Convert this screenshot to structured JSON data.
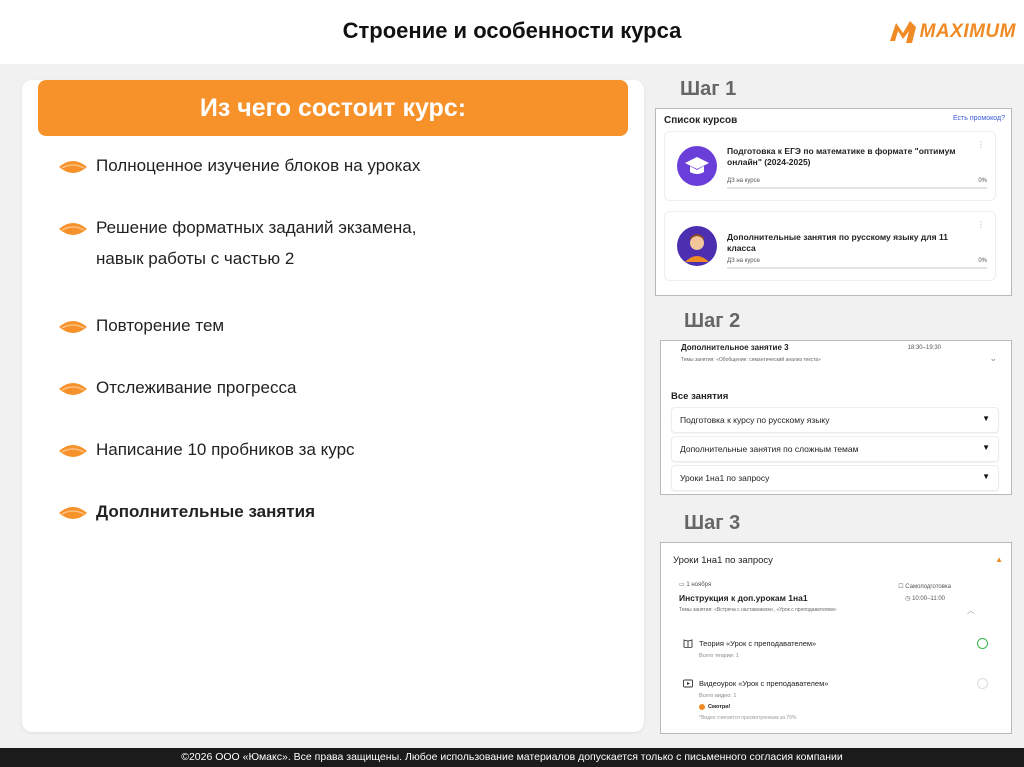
{
  "header": {
    "title": "Строение и особенности курса",
    "logo_text": "MAXIMUM"
  },
  "colors": {
    "accent": "#f7922b",
    "footer_bg": "#1b1b1b",
    "step_label": "#666666"
  },
  "left": {
    "banner": "Из чего состоит курс:",
    "bullets": [
      {
        "line1": "Полноценное изучение блоков на уроках",
        "line2": ""
      },
      {
        "line1": "Решение форматных заданий экзамена,",
        "line2": "навык работы с частью 2"
      },
      {
        "line1": "Повторение тем",
        "line2": ""
      },
      {
        "line1": "Отслеживание прогресса",
        "line2": ""
      },
      {
        "line1": "Написание 10 пробников за курс",
        "line2": ""
      },
      {
        "line1": "Дополнительные занятия",
        "line2": ""
      }
    ]
  },
  "steps": {
    "step1": {
      "label": "Шаг 1",
      "title": "Список курсов",
      "promo": "Есть промокод?",
      "courses": [
        {
          "name": "Подготовка к ЕГЭ по математике в формате \"оптимум онлайн\" (2024-2025)",
          "dz": "ДЗ на курсе",
          "pct": "0%"
        },
        {
          "name": "Дополнительные занятия по русскому языку для 11 класса",
          "dz": "ДЗ на курсе",
          "pct": "0%"
        }
      ]
    },
    "step2": {
      "label": "Шаг 2",
      "lesson_name": "Дополнительное занятие 3",
      "lesson_time": "18:30–19:30",
      "lesson_theme": "Темы занятия: «Обобщение: семантический анализ текста»",
      "all_lessons": "Все занятия",
      "rows": [
        "Подготовка к курсу по русскому языку",
        "Дополнительные занятия по сложным темам",
        "Уроки 1на1 по запросу"
      ]
    },
    "step3": {
      "label": "Шаг 3",
      "header": "Уроки 1на1 по запросу",
      "date": "1 ноября",
      "lesson_name": "Инструкция к доп.урокам 1на1",
      "lesson_theme": "Темы занятия: «Встреча с наставником», «Урок с преподавателем»",
      "self_prep": "Самоподготовка",
      "time": "10:00–11:00",
      "item1_label": "Теория «Урок с преподавателем»",
      "item1_sub": "Всего теории: 1",
      "item2_label": "Видеоурок «Урок с преподавателем»",
      "item2_sub": "Всего видео: 1",
      "watch": "Смотри!",
      "note": "*Видео считается просмотренным за 70%"
    }
  },
  "footer": {
    "text": "©2026 ООО «Юмакс». Все права защищены. Любое использование материалов допускается только с письменного согласия компании"
  }
}
